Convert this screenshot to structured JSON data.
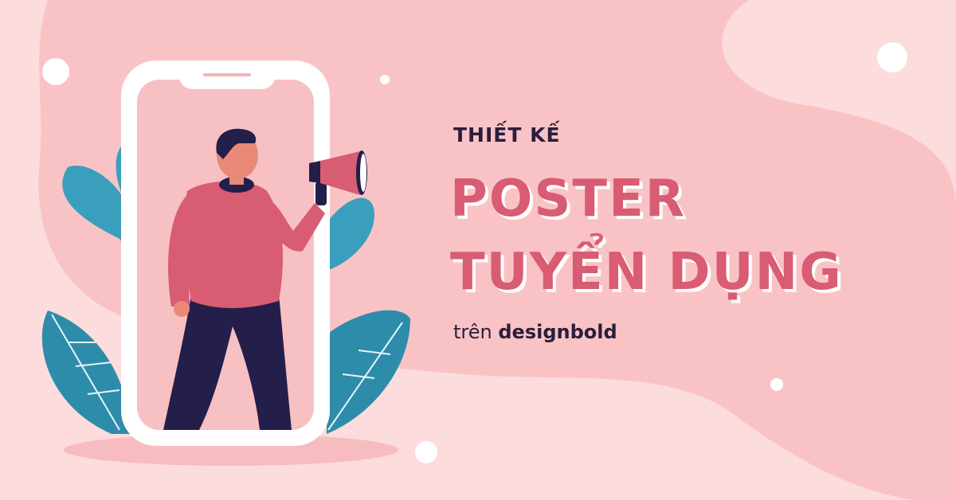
{
  "colors": {
    "background": "#fcdcdc",
    "blob": "#f9c3c5",
    "accent": "#d85c72",
    "dark_text": "#2a1e3c",
    "leaf": "#3a9fbd",
    "phone": "#ffffff",
    "shirt": "#d85c72",
    "pants": "#241e4a"
  },
  "poster": {
    "subtitle": "THIẾT KẾ",
    "headline_line1": "POSTER",
    "headline_line2": "TUYỂN DỤNG",
    "tagline_prefix": "trên",
    "tagline_brand": "designbold"
  },
  "illustration": {
    "figure": "man-with-megaphone",
    "device": "smartphone-frame",
    "plants": "teal-leaves"
  }
}
